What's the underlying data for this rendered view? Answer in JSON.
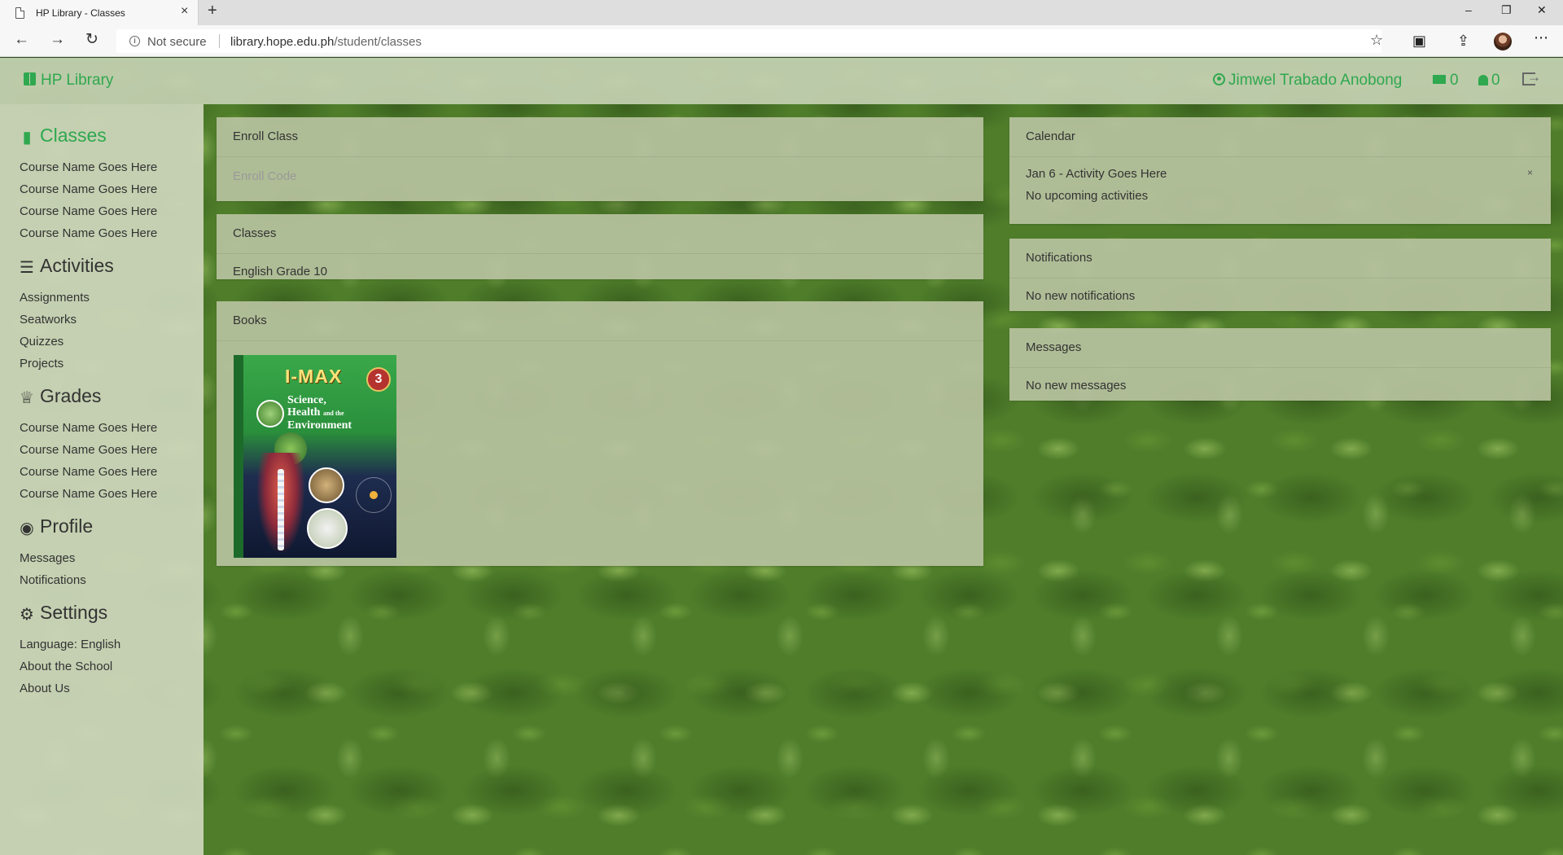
{
  "browser": {
    "tab_title": "HP Library - Classes",
    "tab_close": "×",
    "new_tab": "+",
    "not_secure": "Not secure",
    "url_host": "library.hope.edu.ph",
    "url_path": "/student/classes",
    "icons": [
      "back-icon",
      "forward-icon",
      "refresh-icon",
      "info-icon",
      "star-icon",
      "reading-view-icon",
      "share-icon",
      "profile-avatar",
      "more-icon"
    ]
  },
  "header": {
    "brand": "HP Library",
    "user_name": "Jimwel Trabado Anobong",
    "message_count": "0",
    "notification_count": "0",
    "accent_color": "#2fa84f"
  },
  "sidebar": {
    "sections": [
      {
        "title": "Classes",
        "icon": "book-icon",
        "active": true,
        "items": [
          "Course Name Goes Here",
          "Course Name Goes Here",
          "Course Name Goes Here",
          "Course Name Goes Here"
        ]
      },
      {
        "title": "Activities",
        "icon": "list-icon",
        "items": [
          "Assignments",
          "Seatworks",
          "Quizzes",
          "Projects"
        ]
      },
      {
        "title": "Grades",
        "icon": "trophy-icon",
        "items": [
          "Course Name Goes Here",
          "Course Name Goes Here",
          "Course Name Goes Here",
          "Course Name Goes Here"
        ]
      },
      {
        "title": "Profile",
        "icon": "user-circle-icon",
        "items": [
          "Messages",
          "Notifications"
        ]
      },
      {
        "title": "Settings",
        "icon": "gear-icon",
        "items": [
          "Language: English",
          "About the School",
          "About Us"
        ]
      }
    ]
  },
  "main": {
    "enroll": {
      "title": "Enroll Class",
      "placeholder": "Enroll Code"
    },
    "classes": {
      "title": "Classes",
      "items": [
        "English Grade 10"
      ]
    },
    "books": {
      "title": "Books",
      "cover": {
        "series": "I-MAX",
        "grade": "3",
        "subtitle_1": "Science,",
        "subtitle_2": "Health",
        "subtitle_3": "and the",
        "subtitle_4": "Environment"
      }
    }
  },
  "right": {
    "calendar": {
      "title": "Calendar",
      "event": "Jan 6 - Activity Goes Here",
      "close": "×",
      "empty": "No upcoming activities"
    },
    "notifications": {
      "title": "Notifications",
      "empty": "No new notifications"
    },
    "messages": {
      "title": "Messages",
      "empty": "No new messages"
    }
  }
}
